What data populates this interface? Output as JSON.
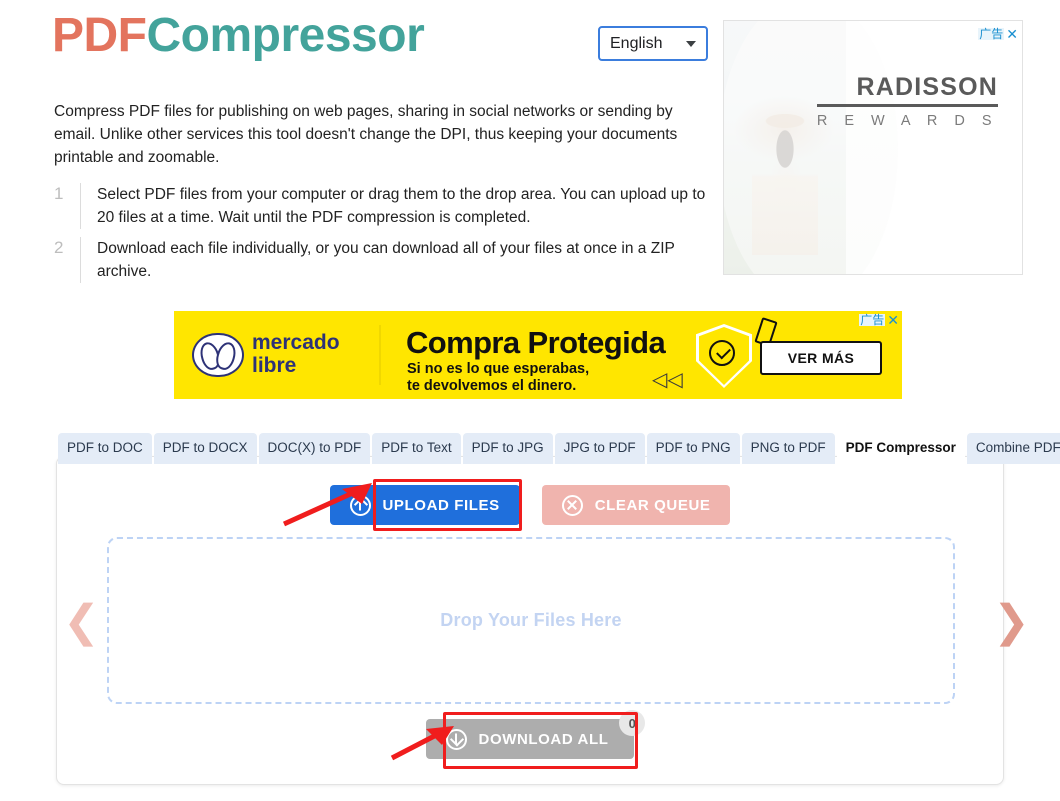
{
  "header": {
    "logo_part1": "PDF",
    "logo_part2": "Compressor",
    "language": "English"
  },
  "intro": {
    "paragraph": "Compress PDF files for publishing on web pages, sharing in social networks or sending by email. Unlike other services this tool doesn't change the DPI, thus keeping your documents printable and zoomable.",
    "steps": [
      {
        "num": "1",
        "text": "Select PDF files from your computer or drag them to the drop area. You can upload up to 20 files at a time. Wait until the PDF compression is completed."
      },
      {
        "num": "2",
        "text": "Download each file individually, or you can download all of your files at once in a ZIP archive."
      }
    ]
  },
  "ads": {
    "label_cn": "广告",
    "close": "✕",
    "right": {
      "brand_line1": "RADISSON",
      "brand_line2": "R E W A R D S"
    },
    "banner": {
      "logo_line1": "mercado",
      "logo_line2": "libre",
      "headline": "Compra Protegida",
      "sub_line1": "Si no es lo que esperabas,",
      "sub_line2": "te devolvemos el dinero.",
      "rewind": "◁◁",
      "cta": "VER MÁS"
    }
  },
  "tabs": [
    {
      "label": "PDF to DOC",
      "active": false
    },
    {
      "label": "PDF to DOCX",
      "active": false
    },
    {
      "label": "DOC(X) to PDF",
      "active": false
    },
    {
      "label": "PDF to Text",
      "active": false
    },
    {
      "label": "PDF to JPG",
      "active": false
    },
    {
      "label": "JPG to PDF",
      "active": false
    },
    {
      "label": "PDF to PNG",
      "active": false
    },
    {
      "label": "PNG to PDF",
      "active": false
    },
    {
      "label": "PDF Compressor",
      "active": true
    },
    {
      "label": "Combine PDF",
      "active": false
    }
  ],
  "tool": {
    "upload_label": "UPLOAD FILES",
    "clear_label": "CLEAR QUEUE",
    "dropzone_text": "Drop Your Files Here",
    "download_label": "DOWNLOAD ALL",
    "download_count": "0",
    "prev_arrow": "❮",
    "next_arrow": "❯"
  },
  "colors": {
    "logo_pdf": "#e3745e",
    "logo_compressor": "#43a39b",
    "upload_blue": "#1f6fdc",
    "clear_pink": "#f0b4ae",
    "download_gray": "#adadad",
    "annotation_red": "#f01d1d",
    "dropzone_border": "#bdd3f5",
    "banner_yellow": "#ffe600"
  }
}
